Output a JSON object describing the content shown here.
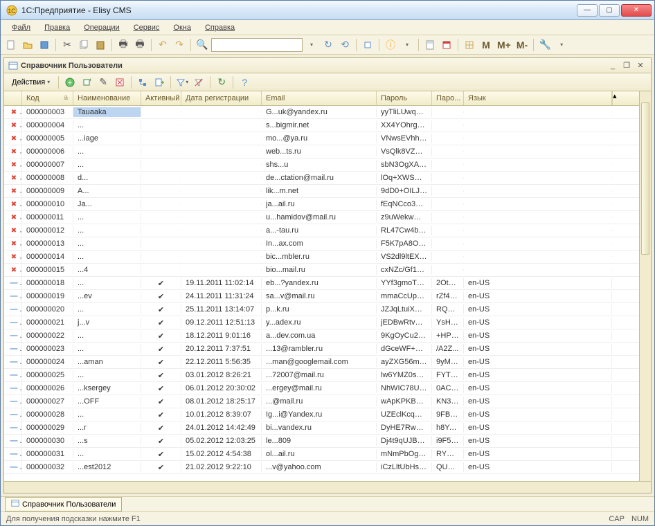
{
  "window": {
    "title": "1С:Предприятие - Elisy CMS"
  },
  "menubar": {
    "items": [
      "Файл",
      "Правка",
      "Операции",
      "Сервис",
      "Окна",
      "Справка"
    ]
  },
  "toolbar": {
    "m_labels": [
      "M",
      "M+",
      "M-"
    ]
  },
  "panel": {
    "title": "Справочник Пользователи",
    "actions_label": "Действия"
  },
  "columns": {
    "code": "Код",
    "name": "Наименование",
    "active": "Активный",
    "date": "Дата регистрации",
    "email": "Email",
    "password": "Пароль",
    "passq": "Паро...",
    "lang": "Язык"
  },
  "rows": [
    {
      "icon": "x",
      "code": "000000003",
      "name": "Tauaaka",
      "active": "",
      "date": "",
      "email": "G...uk@yandex.ru",
      "pass": "yyTliLUwq9X...",
      "passq": "",
      "lang": ""
    },
    {
      "icon": "x",
      "code": "000000004",
      "name": "...",
      "active": "",
      "date": "",
      "email": "s...bigmir.net",
      "pass": "XX4YOhrghyo...",
      "passq": "",
      "lang": ""
    },
    {
      "icon": "x",
      "code": "000000005",
      "name": "...iage",
      "active": "",
      "date": "",
      "email": "mo...@ya.ru",
      "pass": "VNwsEVhhU...",
      "passq": "",
      "lang": ""
    },
    {
      "icon": "x",
      "code": "000000006",
      "name": "...",
      "active": "",
      "date": "",
      "email": "web...ts.ru",
      "pass": "VsQlk8VZDki...",
      "passq": "",
      "lang": ""
    },
    {
      "icon": "x",
      "code": "000000007",
      "name": "...",
      "active": "",
      "date": "",
      "email": "shs...u",
      "pass": "sbN3OgXA7Q...",
      "passq": "",
      "lang": ""
    },
    {
      "icon": "x",
      "code": "000000008",
      "name": "d...",
      "active": "",
      "date": "",
      "email": "de...ctation@mail.ru",
      "pass": "lOq+XWSw4...",
      "passq": "",
      "lang": ""
    },
    {
      "icon": "x",
      "code": "000000009",
      "name": "A...",
      "active": "",
      "date": "",
      "email": "lik...m.net",
      "pass": "9dD0+OILJsK...",
      "passq": "",
      "lang": ""
    },
    {
      "icon": "x",
      "code": "000000010",
      "name": "Ja...",
      "active": "",
      "date": "",
      "email": "ja...ail.ru",
      "pass": "fEqNCco3Yq...",
      "passq": "",
      "lang": ""
    },
    {
      "icon": "x",
      "code": "000000011",
      "name": "...",
      "active": "",
      "date": "",
      "email": "u...hamidov@mail.ru",
      "pass": "z9uWekwQDi...",
      "passq": "",
      "lang": ""
    },
    {
      "icon": "x",
      "code": "000000012",
      "name": "...",
      "active": "",
      "date": "",
      "email": "a...-tau.ru",
      "pass": "RL47Cw4bXa...",
      "passq": "",
      "lang": ""
    },
    {
      "icon": "x",
      "code": "000000013",
      "name": "...",
      "active": "",
      "date": "",
      "email": "In...ax.com",
      "pass": "F5K7pA8Oz5j...",
      "passq": "",
      "lang": ""
    },
    {
      "icon": "x",
      "code": "000000014",
      "name": "...",
      "active": "",
      "date": "",
      "email": "bic...mbler.ru",
      "pass": "VS2dl9ltEXhs...",
      "passq": "",
      "lang": ""
    },
    {
      "icon": "x",
      "code": "000000015",
      "name": "...4",
      "active": "",
      "date": "",
      "email": "bio...mail.ru",
      "pass": "cxNZc/Gf1z5...",
      "passq": "",
      "lang": ""
    },
    {
      "icon": "d",
      "code": "000000018",
      "name": "...",
      "active": "✔",
      "date": "19.11.2011 11:02:14",
      "email": "eb...?yandex.ru",
      "pass": "YYf3gmoTUn...",
      "passq": "2OtAc...",
      "lang": "en-US"
    },
    {
      "icon": "d",
      "code": "000000019",
      "name": "...ev",
      "active": "✔",
      "date": "24.11.2011 11:31:24",
      "email": "sa...v@mail.ru",
      "pass": "mmaCcUpxN...",
      "passq": "rZf4rv...",
      "lang": "en-US"
    },
    {
      "icon": "d",
      "code": "000000020",
      "name": "...",
      "active": "✔",
      "date": "25.11.2011 13:14:07",
      "email": "p...k.ru",
      "pass": "JZJqLtuiXEG...",
      "passq": "RQuH...",
      "lang": "en-US"
    },
    {
      "icon": "d",
      "code": "000000021",
      "name": "j...v",
      "active": "✔",
      "date": "09.12.2011 12:51:13",
      "email": "y...adex.ru",
      "pass": "jEDBwRtvQzX...",
      "passq": "YsHfl...",
      "lang": "en-US"
    },
    {
      "icon": "d",
      "code": "000000022",
      "name": "...",
      "active": "✔",
      "date": "18.12.2011 9:01:16",
      "email": "a...dev.com.ua",
      "pass": "9KgOyCu29Jr...",
      "passq": "+HPY...",
      "lang": "en-US"
    },
    {
      "icon": "d",
      "code": "000000023",
      "name": "...",
      "active": "✔",
      "date": "20.12.2011 7:37:51",
      "email": "...13@rambler.ru",
      "pass": "dGceWF+DO...",
      "passq": "/A2Z...",
      "lang": "en-US"
    },
    {
      "icon": "d",
      "code": "000000024",
      "name": "...aman",
      "active": "✔",
      "date": "22.12.2011 5:56:35",
      "email": "...man@googlemail.com",
      "pass": "ayZXG56mvr...",
      "passq": "9yMb...",
      "lang": "en-US"
    },
    {
      "icon": "d",
      "code": "000000025",
      "name": "...",
      "active": "✔",
      "date": "03.01.2012 8:26:21",
      "email": "...72007@mail.ru",
      "pass": "lw6YMZ0s2m...",
      "passq": "FYTR...",
      "lang": "en-US"
    },
    {
      "icon": "d",
      "code": "000000026",
      "name": "...ksergey",
      "active": "✔",
      "date": "06.01.2012 20:30:02",
      "email": "...ergey@mail.ru",
      "pass": "NhWIC78Ufx...",
      "passq": "0ACu...",
      "lang": "en-US"
    },
    {
      "icon": "d",
      "code": "000000027",
      "name": "...OFF",
      "active": "✔",
      "date": "08.01.2012 18:25:17",
      "email": "...@mail.ru",
      "pass": "wApKPKBH/y...",
      "passq": "KN3O...",
      "lang": "en-US"
    },
    {
      "icon": "d",
      "code": "000000028",
      "name": "...",
      "active": "✔",
      "date": "10.01.2012 8:39:07",
      "email": "Ig...i@Yandex.ru",
      "pass": "UZEclKcqG4...",
      "passq": "9FBq...",
      "lang": "en-US"
    },
    {
      "icon": "d",
      "code": "000000029",
      "name": "...r",
      "active": "✔",
      "date": "24.01.2012 14:42:49",
      "email": "bi...vandex.ru",
      "pass": "DyHE7RwQF...",
      "passq": "h8Ye...",
      "lang": "en-US"
    },
    {
      "icon": "d",
      "code": "000000030",
      "name": "...s",
      "active": "✔",
      "date": "05.02.2012 12:03:25",
      "email": "le...809",
      "pass": "Dj4t9qUJBYK...",
      "passq": "i9F5b...",
      "lang": "en-US"
    },
    {
      "icon": "d",
      "code": "000000031",
      "name": "...",
      "active": "✔",
      "date": "15.02.2012 4:54:38",
      "email": "ol...ail.ru",
      "pass": "mNmPbOgO...",
      "passq": "RYSI...",
      "lang": "en-US"
    },
    {
      "icon": "d",
      "code": "000000032",
      "name": "...est2012",
      "active": "✔",
      "date": "21.02.2012 9:22:10",
      "email": "...v@yahoo.com",
      "pass": "iCzLltUbHssC...",
      "passq": "QUgF...",
      "lang": "en-US"
    }
  ],
  "bottom_tab": {
    "label": "Справочник Пользователи"
  },
  "statusbar": {
    "hint": "Для получения подсказки нажмите F1",
    "cap": "CAP",
    "num": "NUM"
  }
}
